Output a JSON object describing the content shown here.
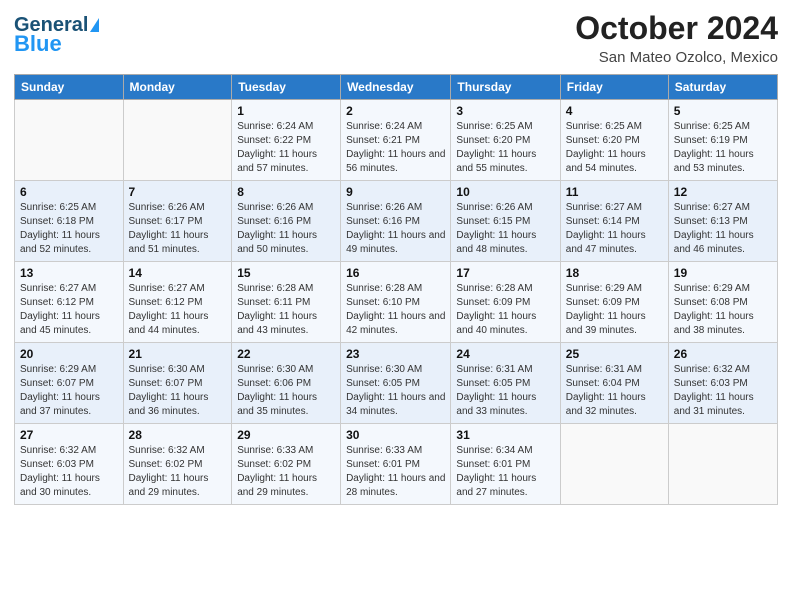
{
  "header": {
    "logo_general": "General",
    "logo_blue": "Blue",
    "title": "October 2024",
    "subtitle": "San Mateo Ozolco, Mexico"
  },
  "weekdays": [
    "Sunday",
    "Monday",
    "Tuesday",
    "Wednesday",
    "Thursday",
    "Friday",
    "Saturday"
  ],
  "weeks": [
    [
      {
        "day": "",
        "info": ""
      },
      {
        "day": "",
        "info": ""
      },
      {
        "day": "1",
        "info": "Sunrise: 6:24 AM\nSunset: 6:22 PM\nDaylight: 11 hours and 57 minutes."
      },
      {
        "day": "2",
        "info": "Sunrise: 6:24 AM\nSunset: 6:21 PM\nDaylight: 11 hours and 56 minutes."
      },
      {
        "day": "3",
        "info": "Sunrise: 6:25 AM\nSunset: 6:20 PM\nDaylight: 11 hours and 55 minutes."
      },
      {
        "day": "4",
        "info": "Sunrise: 6:25 AM\nSunset: 6:20 PM\nDaylight: 11 hours and 54 minutes."
      },
      {
        "day": "5",
        "info": "Sunrise: 6:25 AM\nSunset: 6:19 PM\nDaylight: 11 hours and 53 minutes."
      }
    ],
    [
      {
        "day": "6",
        "info": "Sunrise: 6:25 AM\nSunset: 6:18 PM\nDaylight: 11 hours and 52 minutes."
      },
      {
        "day": "7",
        "info": "Sunrise: 6:26 AM\nSunset: 6:17 PM\nDaylight: 11 hours and 51 minutes."
      },
      {
        "day": "8",
        "info": "Sunrise: 6:26 AM\nSunset: 6:16 PM\nDaylight: 11 hours and 50 minutes."
      },
      {
        "day": "9",
        "info": "Sunrise: 6:26 AM\nSunset: 6:16 PM\nDaylight: 11 hours and 49 minutes."
      },
      {
        "day": "10",
        "info": "Sunrise: 6:26 AM\nSunset: 6:15 PM\nDaylight: 11 hours and 48 minutes."
      },
      {
        "day": "11",
        "info": "Sunrise: 6:27 AM\nSunset: 6:14 PM\nDaylight: 11 hours and 47 minutes."
      },
      {
        "day": "12",
        "info": "Sunrise: 6:27 AM\nSunset: 6:13 PM\nDaylight: 11 hours and 46 minutes."
      }
    ],
    [
      {
        "day": "13",
        "info": "Sunrise: 6:27 AM\nSunset: 6:12 PM\nDaylight: 11 hours and 45 minutes."
      },
      {
        "day": "14",
        "info": "Sunrise: 6:27 AM\nSunset: 6:12 PM\nDaylight: 11 hours and 44 minutes."
      },
      {
        "day": "15",
        "info": "Sunrise: 6:28 AM\nSunset: 6:11 PM\nDaylight: 11 hours and 43 minutes."
      },
      {
        "day": "16",
        "info": "Sunrise: 6:28 AM\nSunset: 6:10 PM\nDaylight: 11 hours and 42 minutes."
      },
      {
        "day": "17",
        "info": "Sunrise: 6:28 AM\nSunset: 6:09 PM\nDaylight: 11 hours and 40 minutes."
      },
      {
        "day": "18",
        "info": "Sunrise: 6:29 AM\nSunset: 6:09 PM\nDaylight: 11 hours and 39 minutes."
      },
      {
        "day": "19",
        "info": "Sunrise: 6:29 AM\nSunset: 6:08 PM\nDaylight: 11 hours and 38 minutes."
      }
    ],
    [
      {
        "day": "20",
        "info": "Sunrise: 6:29 AM\nSunset: 6:07 PM\nDaylight: 11 hours and 37 minutes."
      },
      {
        "day": "21",
        "info": "Sunrise: 6:30 AM\nSunset: 6:07 PM\nDaylight: 11 hours and 36 minutes."
      },
      {
        "day": "22",
        "info": "Sunrise: 6:30 AM\nSunset: 6:06 PM\nDaylight: 11 hours and 35 minutes."
      },
      {
        "day": "23",
        "info": "Sunrise: 6:30 AM\nSunset: 6:05 PM\nDaylight: 11 hours and 34 minutes."
      },
      {
        "day": "24",
        "info": "Sunrise: 6:31 AM\nSunset: 6:05 PM\nDaylight: 11 hours and 33 minutes."
      },
      {
        "day": "25",
        "info": "Sunrise: 6:31 AM\nSunset: 6:04 PM\nDaylight: 11 hours and 32 minutes."
      },
      {
        "day": "26",
        "info": "Sunrise: 6:32 AM\nSunset: 6:03 PM\nDaylight: 11 hours and 31 minutes."
      }
    ],
    [
      {
        "day": "27",
        "info": "Sunrise: 6:32 AM\nSunset: 6:03 PM\nDaylight: 11 hours and 30 minutes."
      },
      {
        "day": "28",
        "info": "Sunrise: 6:32 AM\nSunset: 6:02 PM\nDaylight: 11 hours and 29 minutes."
      },
      {
        "day": "29",
        "info": "Sunrise: 6:33 AM\nSunset: 6:02 PM\nDaylight: 11 hours and 29 minutes."
      },
      {
        "day": "30",
        "info": "Sunrise: 6:33 AM\nSunset: 6:01 PM\nDaylight: 11 hours and 28 minutes."
      },
      {
        "day": "31",
        "info": "Sunrise: 6:34 AM\nSunset: 6:01 PM\nDaylight: 11 hours and 27 minutes."
      },
      {
        "day": "",
        "info": ""
      },
      {
        "day": "",
        "info": ""
      }
    ]
  ]
}
